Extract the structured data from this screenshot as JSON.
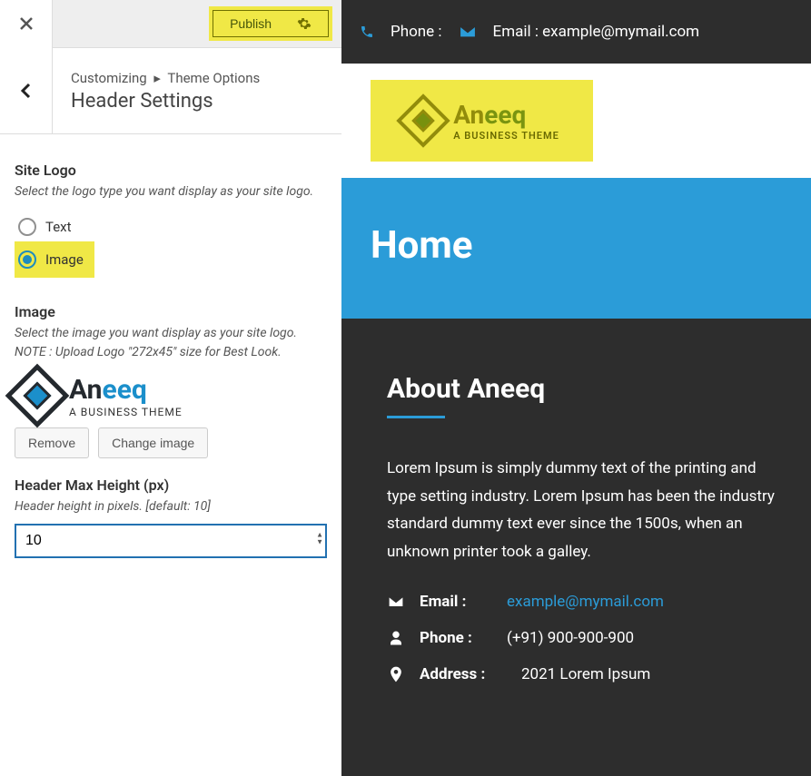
{
  "topbar": {
    "publish_label": "Publish"
  },
  "breadcrumb": {
    "customizing": "Customizing",
    "section": "Theme Options",
    "title": "Header Settings"
  },
  "site_logo": {
    "heading": "Site Logo",
    "desc": "Select the logo type you want display as your site logo.",
    "option_text": "Text",
    "option_image": "Image"
  },
  "image_section": {
    "heading": "Image",
    "desc": "Select the image you want display as your site logo. NOTE : Upload Logo \"272x45\" size for Best Look.",
    "remove_label": "Remove",
    "change_label": "Change image"
  },
  "height_section": {
    "heading": "Header Max Height (px)",
    "desc": "Header height in pixels. [default: 10]",
    "value": "10"
  },
  "preview": {
    "logo_brand_a": "An",
    "logo_brand_b": "eeq",
    "logo_tagline": "A BUSINESS THEME",
    "phone_label": "Phone :",
    "email_label": "Email : example@mymail.com",
    "hero_title": "Home",
    "about_heading": "About Aneeq",
    "about_body": "Lorem Ipsum is simply dummy text of the printing and type setting industry. Lorem Ipsum has been the industry standard dummy text ever since the 1500s, when an unknown printer took a galley.",
    "contact": {
      "email_lbl": "Email :",
      "email_val": "example@mymail.com",
      "phone_lbl": "Phone :",
      "phone_val": "(+91) 900-900-900",
      "address_lbl": "Address :",
      "address_val": "2021 Lorem Ipsum"
    }
  }
}
